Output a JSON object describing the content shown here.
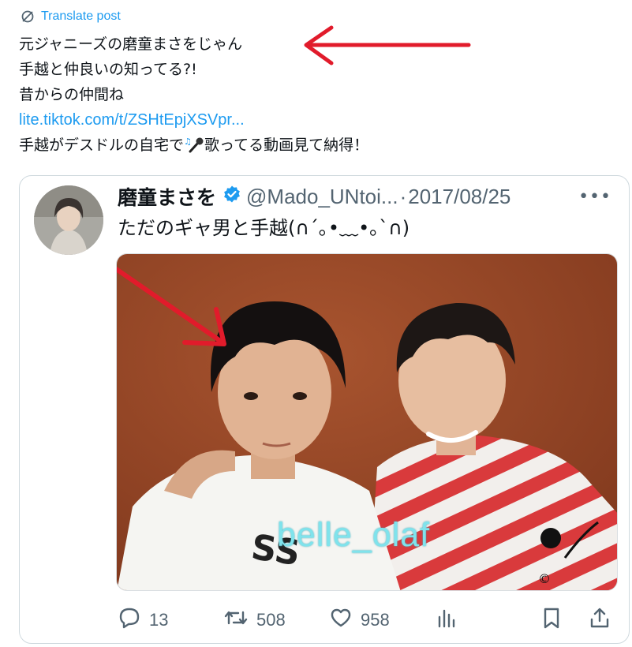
{
  "translate": {
    "label": "Translate post",
    "icon": "globe-translate-icon"
  },
  "post": {
    "line1": "元ジャニーズの磨童まさをじゃん",
    "line2": "手越と仲良いの知ってる?!",
    "line3": "昔からの仲間ね",
    "link": "lite.tiktok.com/t/ZSHtEpjXSVpr...",
    "line5a": "手越がデスドルの自宅で",
    "line5b": "歌ってる動画見て納得！"
  },
  "quoted": {
    "name": "磨童まさを",
    "handle": "@Mado_UNtoi...",
    "separator": "·",
    "date": "2017/08/25",
    "more": "•••",
    "text": "ただのギャ男と手越(∩´｡•﹏•｡`∩)",
    "photo_watermark": "belle_olaf"
  },
  "actions": {
    "replies": "13",
    "reposts": "508",
    "likes": "958"
  },
  "colors": {
    "accent": "#1d9bf0",
    "muted": "#536471",
    "arrow": "#e11b2b"
  }
}
